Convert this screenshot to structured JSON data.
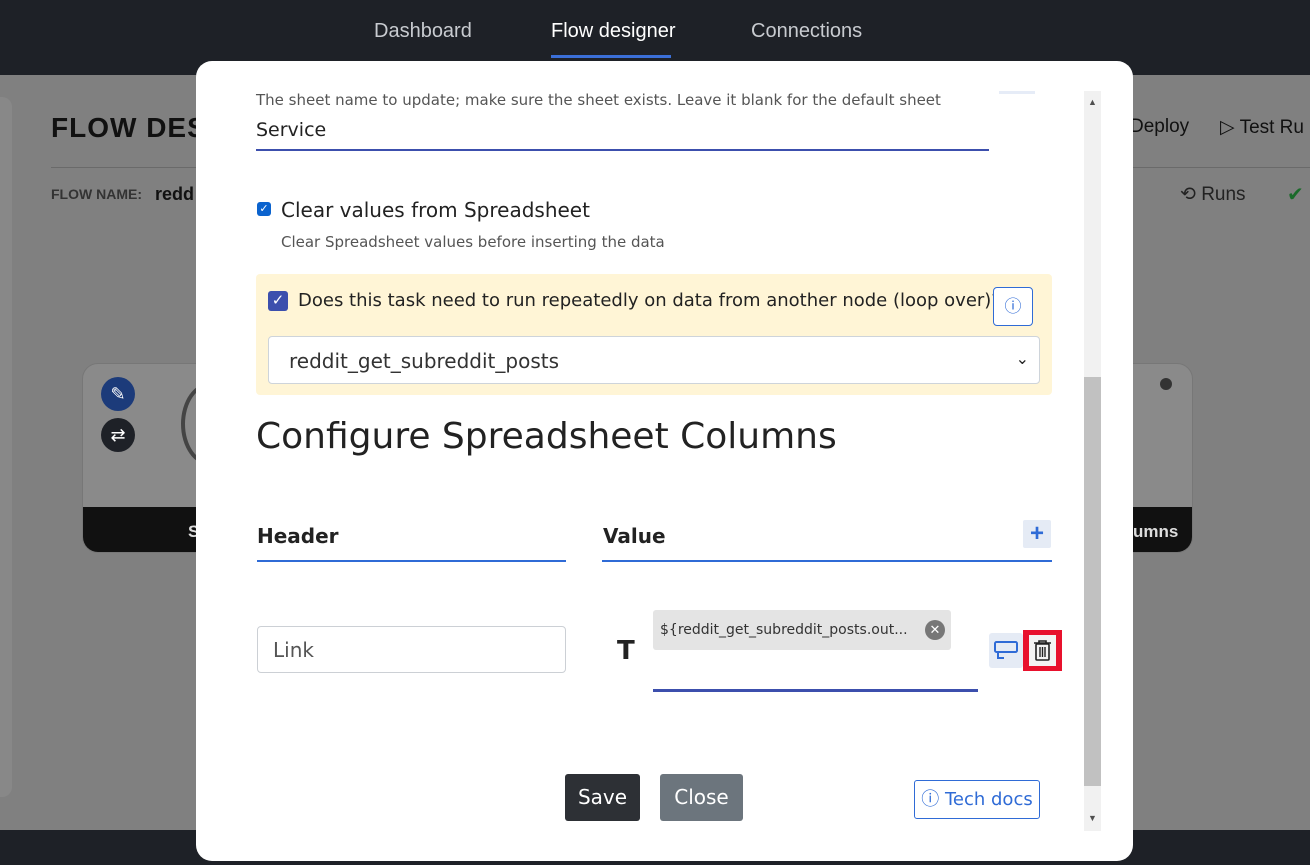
{
  "nav": {
    "tabs": [
      {
        "label": "Dashboard"
      },
      {
        "label": "Flow designer"
      },
      {
        "label": "Connections"
      }
    ]
  },
  "background": {
    "title": "FLOW DES",
    "flow_name_label": "FLOW NAME:",
    "flow_name_value": "redd",
    "deploy_label": "Deploy",
    "test_run_label": "Test Ru",
    "runs_label": "Runs",
    "node_left_label": "S",
    "node_right_label": "umns"
  },
  "modal": {
    "sheet_hint": "The sheet name to update; make sure the sheet exists. Leave it blank for the default sheet",
    "sheet_value": "Service",
    "clear_values": {
      "label": "Clear values from Spreadsheet",
      "description": "Clear Spreadsheet values before inserting the data",
      "checked": true
    },
    "loop": {
      "label": "Does this task need to run repeatedly on data from another node (loop over)?",
      "checked": true,
      "selected": "reddit_get_subreddit_posts",
      "info_icon": "info-icon"
    },
    "section_title": "Configure Spreadsheet Columns",
    "columns": {
      "header_label": "Header",
      "value_label": "Value",
      "add_icon": "plus-icon"
    },
    "rows": [
      {
        "header": "Link",
        "type_icon": "T",
        "chip_text": "${reddit_get_subreddit_posts.out...",
        "expression_icon": "expression-icon",
        "delete_icon": "trash-icon"
      }
    ],
    "buttons": {
      "save": "Save",
      "close": "Close",
      "tech_docs": "ⓘ Tech docs"
    }
  },
  "colors": {
    "accent": "#2f6bd6",
    "underline": "#3c4fad",
    "loop_bg": "#fff5d6",
    "delete_highlight": "#e8112d",
    "save_bg": "#2d3035",
    "close_bg": "#6c757d"
  }
}
